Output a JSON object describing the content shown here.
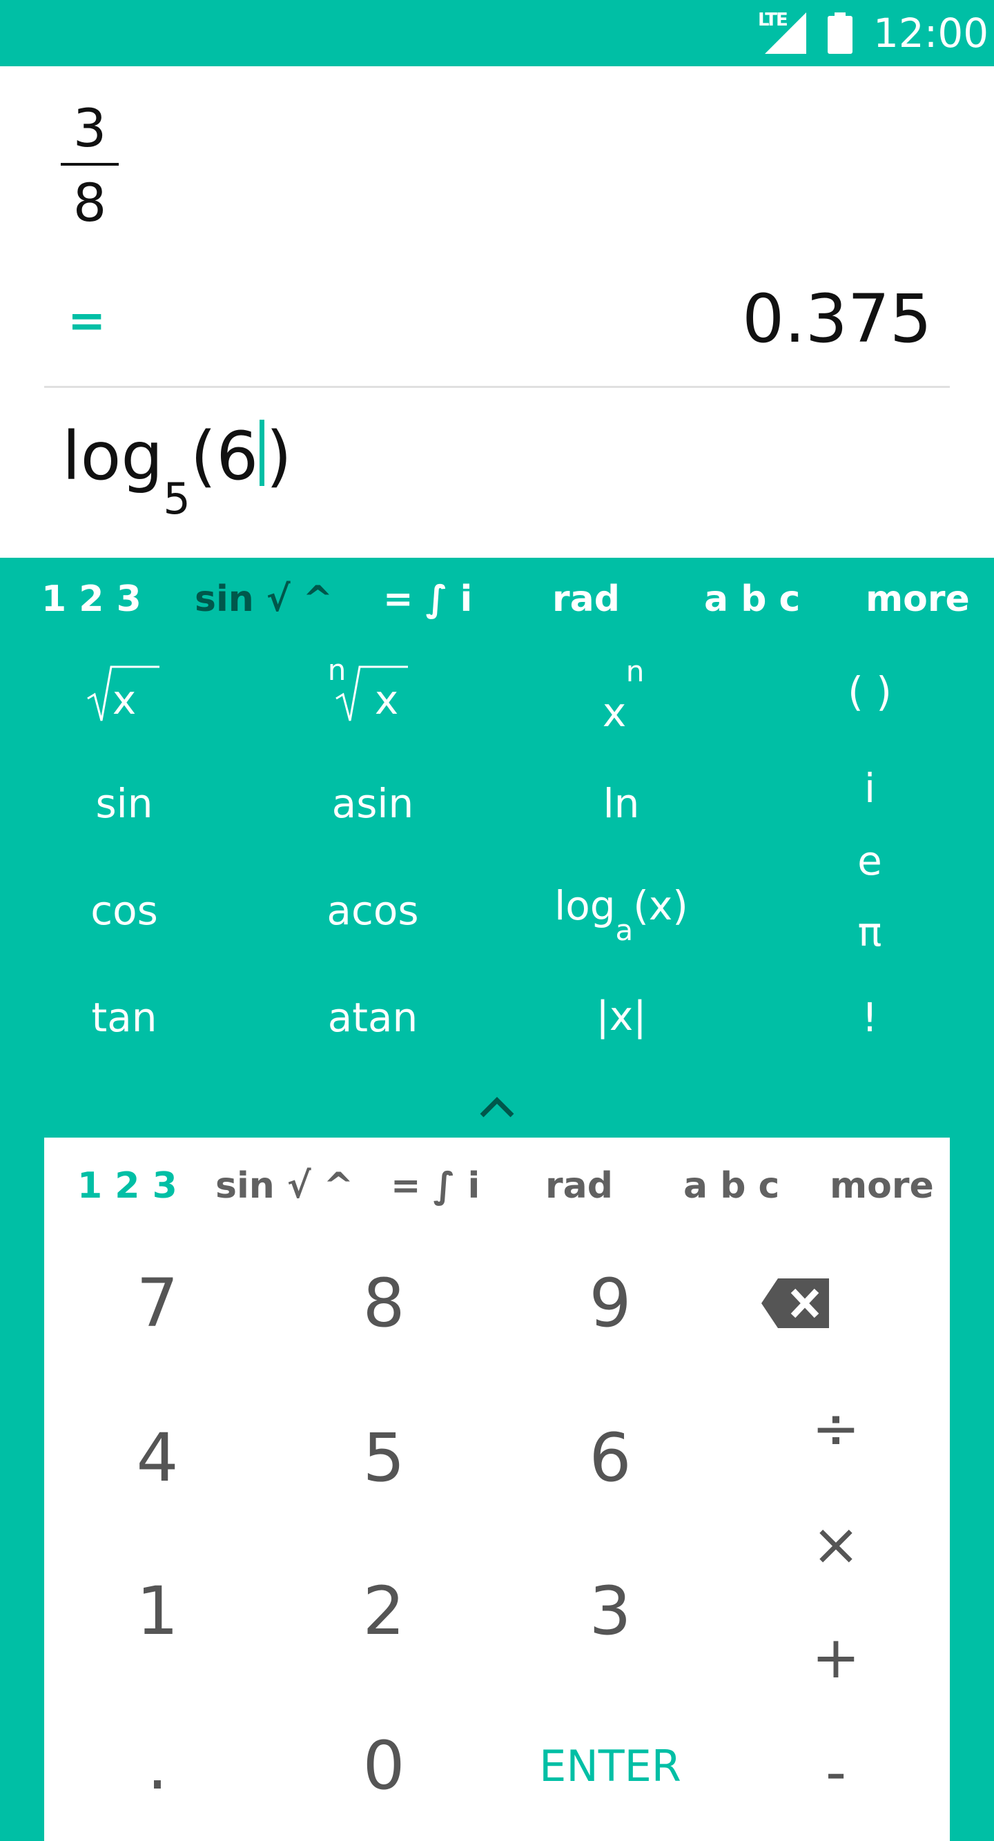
{
  "status_bar": {
    "network": "LTE",
    "time": "12:00"
  },
  "display": {
    "fraction": {
      "numerator": "3",
      "denominator": "8"
    },
    "equals_sign": "=",
    "result": "0.375",
    "input": {
      "func": "log",
      "base": "5",
      "open": "(",
      "arg": "6",
      "close": ")"
    }
  },
  "upper_tabs": [
    "1 2 3",
    "sin √ ^",
    "= ∫ i",
    "rad",
    "a b c",
    "more"
  ],
  "upper_active_tab": "sin √ ^",
  "function_keys": {
    "sqrt": {
      "radicand": "x"
    },
    "nth_root": {
      "index": "n",
      "radicand": "x"
    },
    "power": {
      "base": "x",
      "exp": "n"
    },
    "parens": "( )",
    "sin": "sin",
    "asin": "asin",
    "ln": "ln",
    "cos": "cos",
    "acos": "acos",
    "log_a": {
      "func": "log",
      "base": "a",
      "arg": "(x)"
    },
    "tan": "tan",
    "atan": "atan",
    "abs": "|x|",
    "i": "i",
    "e": "e",
    "pi": "π",
    "factorial": "!"
  },
  "lower_tabs": [
    "1 2 3",
    "sin √ ^",
    "= ∫ i",
    "rad",
    "a b c",
    "more"
  ],
  "lower_active_tab": "1 2 3",
  "number_keys": {
    "seven": "7",
    "eight": "8",
    "nine": "9",
    "four": "4",
    "five": "5",
    "six": "6",
    "one": "1",
    "two": "2",
    "three": "3",
    "dot": ".",
    "zero": "0",
    "enter": "ENTER"
  },
  "operator_keys": {
    "divide": "÷",
    "multiply": "×",
    "plus": "+",
    "minus": "-"
  },
  "colors": {
    "accent": "#00BFA5",
    "dark_accent": "#00574b",
    "key_text": "#555555"
  }
}
